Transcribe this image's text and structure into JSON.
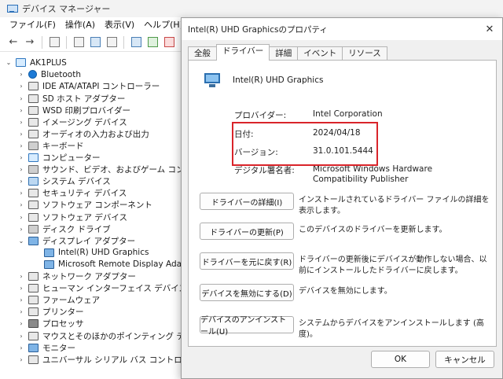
{
  "window": {
    "title": "デバイス マネージャー"
  },
  "menu": {
    "items": [
      "ファイル(F)",
      "操作(A)",
      "表示(V)",
      "ヘルプ(H)"
    ]
  },
  "tree": {
    "root": "AK1PLUS",
    "items": [
      {
        "label": "Bluetooth",
        "icon": "bluetooth-icon"
      },
      {
        "label": "IDE ATA/ATAPI コントローラー",
        "icon": "ide-controller-icon"
      },
      {
        "label": "SD ホスト アダプター",
        "icon": "sd-host-icon"
      },
      {
        "label": "WSD 印刷プロバイダー",
        "icon": "printer-provider-icon"
      },
      {
        "label": "イメージング デバイス",
        "icon": "camera-icon"
      },
      {
        "label": "オーディオの入力および出力",
        "icon": "speaker-icon"
      },
      {
        "label": "キーボード",
        "icon": "keyboard-icon"
      },
      {
        "label": "コンピューター",
        "icon": "computer-icon"
      },
      {
        "label": "サウンド、ビデオ、およびゲーム コントローラー",
        "icon": "sound-controller-icon"
      },
      {
        "label": "システム デバイス",
        "icon": "system-device-icon"
      },
      {
        "label": "セキュリティ デバイス",
        "icon": "security-device-icon"
      },
      {
        "label": "ソフトウェア コンポーネント",
        "icon": "software-component-icon"
      },
      {
        "label": "ソフトウェア デバイス",
        "icon": "software-device-icon"
      },
      {
        "label": "ディスク ドライブ",
        "icon": "disk-drive-icon"
      },
      {
        "label": "ディスプレイ アダプター",
        "icon": "display-adapter-icon",
        "expanded": true
      },
      {
        "label": "Intel(R) UHD Graphics",
        "icon": "monitor-icon",
        "child": true
      },
      {
        "label": "Microsoft Remote Display Adapter",
        "icon": "monitor-icon",
        "child": true
      },
      {
        "label": "ネットワーク アダプター",
        "icon": "network-adapter-icon"
      },
      {
        "label": "ヒューマン インターフェイス デバイス",
        "icon": "hid-icon"
      },
      {
        "label": "ファームウェア",
        "icon": "firmware-icon"
      },
      {
        "label": "プリンター",
        "icon": "printer-icon"
      },
      {
        "label": "プロセッサ",
        "icon": "processor-icon"
      },
      {
        "label": "マウスとそのほかのポインティング デバイス",
        "icon": "mouse-icon"
      },
      {
        "label": "モニター",
        "icon": "monitor-icon"
      },
      {
        "label": "ユニバーサル シリアル バス コントローラー",
        "icon": "usb-icon"
      }
    ]
  },
  "dialog": {
    "title": "Intel(R) UHD Graphicsのプロパティ",
    "tabs": [
      "全般",
      "ドライバー",
      "詳細",
      "イベント",
      "リソース"
    ],
    "active_tab": "ドライバー",
    "device_name": "Intel(R) UHD Graphics",
    "info": [
      {
        "key": "プロバイダー:",
        "value": "Intel Corporation"
      },
      {
        "key": "日付:",
        "value": "2024/04/18"
      },
      {
        "key": "バージョン:",
        "value": "31.0.101.5444"
      },
      {
        "key": "デジタル署名者:",
        "value": "Microsoft Windows Hardware Compatibility Publisher"
      }
    ],
    "actions": [
      {
        "button": "ドライバーの詳細(I)",
        "desc": "インストールされているドライバー ファイルの詳細を表示します。"
      },
      {
        "button": "ドライバーの更新(P)",
        "desc": "このデバイスのドライバーを更新します。"
      },
      {
        "button": "ドライバーを元に戻す(R)",
        "desc": "ドライバーの更新後にデバイスが動作しない場合、以前にインストールしたドライバーに戻します。"
      },
      {
        "button": "デバイスを無効にする(D)",
        "desc": "デバイスを無効にします。"
      },
      {
        "button": "デバイスのアンインストール(U)",
        "desc": "システムからデバイスをアンインストールします (高度)。"
      }
    ],
    "ok_label": "OK",
    "cancel_label": "キャンセル",
    "highlight_color": "#d9242a"
  }
}
